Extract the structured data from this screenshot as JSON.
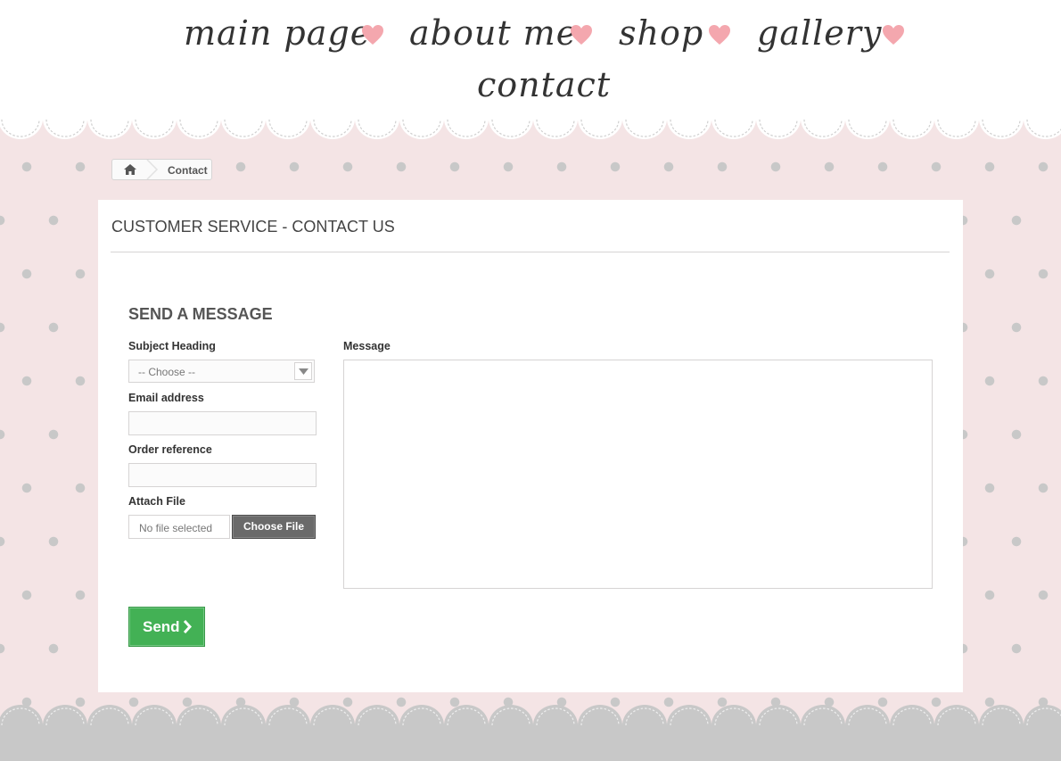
{
  "menu": {
    "items": [
      {
        "label": "main page"
      },
      {
        "label": "about me"
      },
      {
        "label": "shop"
      },
      {
        "label": "gallery"
      },
      {
        "label": "contact"
      }
    ]
  },
  "breadcrumb": {
    "home_icon": "home-icon",
    "current": "Contact"
  },
  "page": {
    "title": "CUSTOMER SERVICE - CONTACT US"
  },
  "form": {
    "heading": "SEND A MESSAGE",
    "subject_label": "Subject Heading",
    "subject_value": "-- Choose --",
    "email_label": "Email address",
    "email_value": "",
    "order_label": "Order reference",
    "order_value": "",
    "attach_label": "Attach File",
    "file_status": "No file selected",
    "file_button": "Choose File",
    "message_label": "Message",
    "message_value": "",
    "send_label": "Send"
  },
  "colors": {
    "background": "#f4e4e5",
    "dots": "#c8c8c8",
    "heart": "#f4a7ae",
    "send_button": "#43b155",
    "file_button": "#6a6a6a"
  }
}
